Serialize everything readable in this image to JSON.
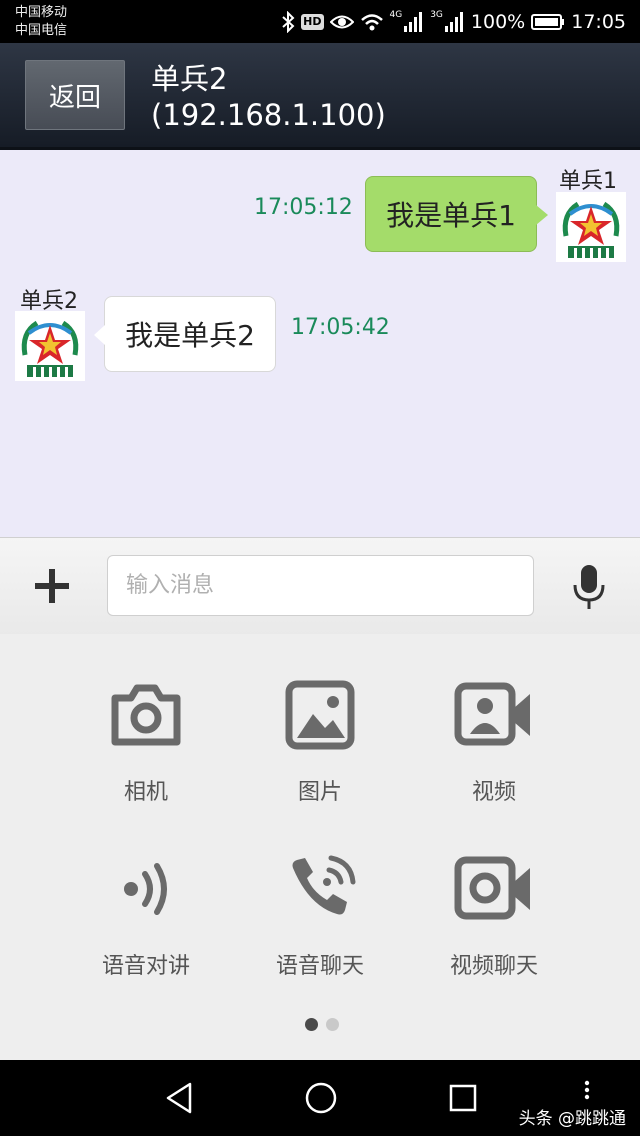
{
  "status_bar": {
    "carrier_1": "中国移动",
    "carrier_2": "中国电信",
    "hd_badge": "HD",
    "network_1": "4G",
    "network_2": "3G",
    "battery": "100%",
    "time": "17:05",
    "icons": [
      "bluetooth-icon",
      "hd-icon",
      "eye-icon",
      "wifi-icon",
      "signal-icon",
      "signal-icon",
      "battery-icon"
    ]
  },
  "header": {
    "back_label": "返回",
    "peer_name": "单兵2",
    "peer_ip": "(192.168.1.100)"
  },
  "messages": [
    {
      "direction": "out",
      "sender": "单兵1",
      "text": "我是单兵1",
      "time": "17:05:12"
    },
    {
      "direction": "in",
      "sender": "单兵2",
      "text": "我是单兵2",
      "time": "17:05:42"
    }
  ],
  "input": {
    "placeholder": "输入消息",
    "value": ""
  },
  "functions": [
    {
      "label": "相机",
      "icon": "camera-icon"
    },
    {
      "label": "图片",
      "icon": "image-icon"
    },
    {
      "label": "视频",
      "icon": "video-contact-icon"
    },
    {
      "label": "语音对讲",
      "icon": "voice-intercom-icon"
    },
    {
      "label": "语音聊天",
      "icon": "phone-call-icon"
    },
    {
      "label": "视频聊天",
      "icon": "video-camera-icon"
    }
  ],
  "pager": {
    "pages": 2,
    "current": 1
  },
  "watermark": "头条 @跳跳通",
  "colors": {
    "outgoing_bubble": "#a4dc6a",
    "timestamp": "#1a8a5a",
    "chat_background": "#eceaf9"
  }
}
